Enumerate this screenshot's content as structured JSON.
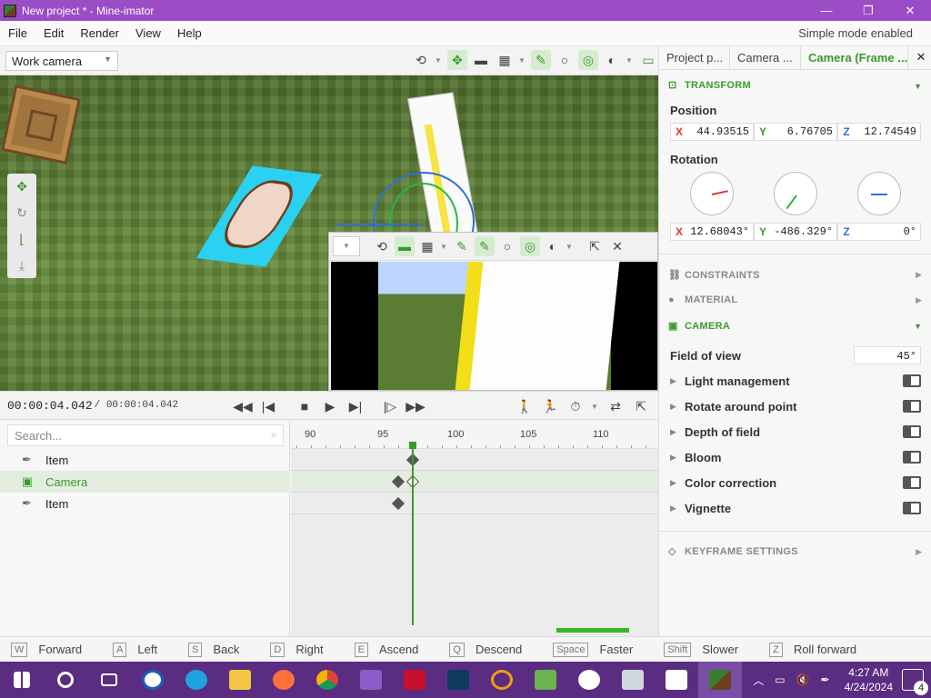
{
  "window": {
    "title": "New project * - Mine-imator",
    "min": "—",
    "max": "❐",
    "close": "✕"
  },
  "menu": {
    "items": [
      "File",
      "Edit",
      "Render",
      "View",
      "Help"
    ],
    "simple_mode": "Simple mode enabled"
  },
  "viewport": {
    "camera_select": "Work camera"
  },
  "transport": {
    "time_current": "00:00:04.042",
    "time_total": "/ 00:00:04.042"
  },
  "tree": {
    "search_placeholder": "Search...",
    "items": [
      {
        "label": "Item",
        "selected": false
      },
      {
        "label": "Camera",
        "selected": true
      },
      {
        "label": "Item",
        "selected": false
      }
    ]
  },
  "timeline": {
    "ticks": [
      "90",
      "95",
      "100",
      "105",
      "110"
    ]
  },
  "keys": [
    {
      "key": "W",
      "label": "Forward"
    },
    {
      "key": "A",
      "label": "Left"
    },
    {
      "key": "S",
      "label": "Back"
    },
    {
      "key": "D",
      "label": "Right"
    },
    {
      "key": "E",
      "label": "Ascend"
    },
    {
      "key": "Q",
      "label": "Descend"
    },
    {
      "key": "Space",
      "label": "Faster"
    },
    {
      "key": "Shift",
      "label": "Slower"
    },
    {
      "key": "Z",
      "label": "Roll forward"
    }
  ],
  "right_panel": {
    "tabs": [
      "Project p...",
      "Camera ...",
      "Camera (Frame ..."
    ],
    "close": "✕",
    "transform": {
      "title": "TRANSFORM",
      "position_label": "Position",
      "position": {
        "x": "44.93515",
        "y": "6.76705",
        "z": "12.74549"
      },
      "rotation_label": "Rotation",
      "rotation": {
        "x": "12.68043°",
        "y": "-486.329°",
        "z": "0°"
      }
    },
    "sections": {
      "constraints": "CONSTRAINTS",
      "material": "MATERIAL",
      "camera": "CAMERA",
      "keyframe": "KEYFRAME SETTINGS"
    },
    "camera": {
      "fov_label": "Field of view",
      "fov_value": "45°",
      "props": [
        "Light management",
        "Rotate around point",
        "Depth of field",
        "Bloom",
        "Color correction",
        "Vignette"
      ]
    }
  },
  "taskbar": {
    "time": "4:27 AM",
    "date": "4/24/2024",
    "notifications": "4"
  },
  "colors": {
    "accent": "#3b9a2c",
    "titlebar": "#9b4dc6",
    "taskbar": "#5a2c82"
  }
}
